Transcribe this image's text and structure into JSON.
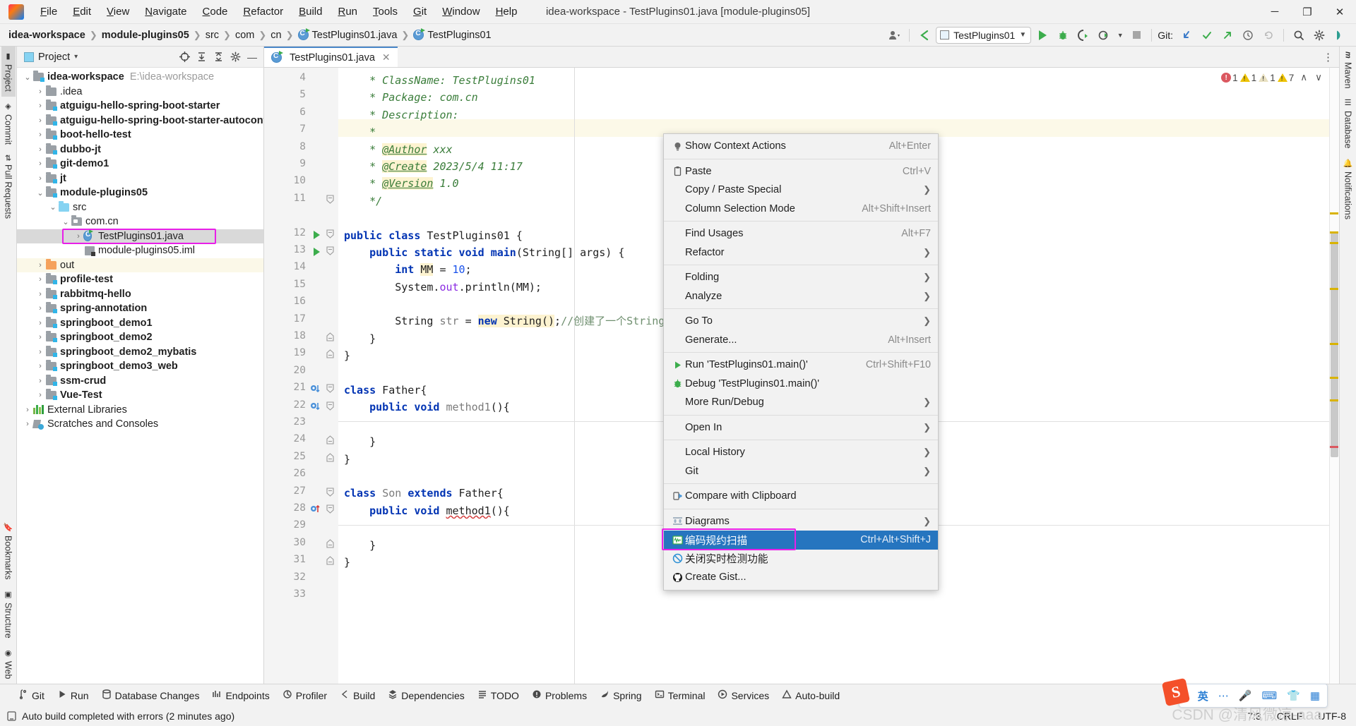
{
  "window": {
    "title": "idea-workspace - TestPlugins01.java [module-plugins05]",
    "minimize": "─",
    "maximize": "❐",
    "close": "✕",
    "logo_text": "IJ"
  },
  "menubar": [
    {
      "label": "File"
    },
    {
      "label": "Edit"
    },
    {
      "label": "View"
    },
    {
      "label": "Navigate"
    },
    {
      "label": "Code"
    },
    {
      "label": "Refactor"
    },
    {
      "label": "Build"
    },
    {
      "label": "Run"
    },
    {
      "label": "Tools"
    },
    {
      "label": "Git"
    },
    {
      "label": "Window"
    },
    {
      "label": "Help"
    }
  ],
  "breadcrumb": [
    {
      "label": "idea-workspace",
      "bold": true,
      "icon": ""
    },
    {
      "label": "module-plugins05",
      "bold": true,
      "icon": ""
    },
    {
      "label": "src",
      "bold": false,
      "icon": ""
    },
    {
      "label": "com",
      "bold": false,
      "icon": ""
    },
    {
      "label": "cn",
      "bold": false,
      "icon": ""
    },
    {
      "label": "TestPlugins01.java",
      "bold": false,
      "icon": "class-icon"
    },
    {
      "label": "TestPlugins01",
      "bold": false,
      "icon": "class-icon"
    }
  ],
  "toolbar": {
    "run_config": "TestPlugins01",
    "git_label": "Git:",
    "icons": [
      "user-icon",
      "back-arrow-icon",
      "run-icon",
      "debug-icon",
      "run-coverage-icon",
      "profile-icon",
      "stop-icon",
      "git-update-icon",
      "git-commit-icon",
      "git-push-icon",
      "history-icon",
      "rollback-icon",
      "search-everywhere-icon",
      "settings-icon",
      "ide-assistant-icon"
    ]
  },
  "left_strip": [
    {
      "label": "Project",
      "icon": "project-icon",
      "active": true
    },
    {
      "label": "Commit",
      "icon": "commit-icon",
      "active": false
    },
    {
      "label": "Pull Requests",
      "icon": "pull-requests-icon",
      "active": false
    },
    {
      "label": "Bookmarks",
      "icon": "bookmarks-icon",
      "active": false
    },
    {
      "label": "Structure",
      "icon": "structure-icon",
      "active": false
    },
    {
      "label": "Web",
      "icon": "web-icon",
      "active": false
    }
  ],
  "right_strip": [
    {
      "label": "Maven",
      "icon": "maven-icon"
    },
    {
      "label": "Database",
      "icon": "database-icon"
    },
    {
      "label": "Notifications",
      "icon": "notifications-icon"
    }
  ],
  "project_panel": {
    "title": "Project",
    "dropdown": "▾",
    "actions": [
      "select-opened-file-icon",
      "expand-all-icon",
      "collapse-all-icon",
      "settings-icon",
      "hide-icon"
    ],
    "tree": [
      {
        "indent": 0,
        "arrow": "⌄",
        "icon": "module-folder",
        "label": "idea-workspace",
        "bold": true,
        "sub": "E:\\idea-workspace",
        "state": ""
      },
      {
        "indent": 1,
        "arrow": "›",
        "icon": "plain-folder",
        "label": ".idea",
        "bold": false,
        "sub": "",
        "state": ""
      },
      {
        "indent": 1,
        "arrow": "›",
        "icon": "module-folder",
        "label": "atguigu-hello-spring-boot-starter",
        "bold": true,
        "sub": "",
        "state": ""
      },
      {
        "indent": 1,
        "arrow": "›",
        "icon": "module-folder",
        "label": "atguigu-hello-spring-boot-starter-autoconfigu",
        "bold": true,
        "sub": "",
        "state": ""
      },
      {
        "indent": 1,
        "arrow": "›",
        "icon": "module-folder",
        "label": "boot-hello-test",
        "bold": true,
        "sub": "",
        "state": ""
      },
      {
        "indent": 1,
        "arrow": "›",
        "icon": "module-folder",
        "label": "dubbo-jt",
        "bold": true,
        "sub": "",
        "state": ""
      },
      {
        "indent": 1,
        "arrow": "›",
        "icon": "module-folder",
        "label": "git-demo1",
        "bold": true,
        "sub": "",
        "state": ""
      },
      {
        "indent": 1,
        "arrow": "›",
        "icon": "module-folder",
        "label": "jt",
        "bold": true,
        "sub": "",
        "state": ""
      },
      {
        "indent": 1,
        "arrow": "⌄",
        "icon": "module-folder",
        "label": "module-plugins05",
        "bold": true,
        "sub": "",
        "state": ""
      },
      {
        "indent": 2,
        "arrow": "⌄",
        "icon": "src-folder",
        "label": "src",
        "bold": false,
        "sub": "",
        "state": ""
      },
      {
        "indent": 3,
        "arrow": "⌄",
        "icon": "pkg-folder",
        "label": "com.cn",
        "bold": false,
        "sub": "",
        "state": ""
      },
      {
        "indent": 4,
        "arrow": "›",
        "icon": "class-icon",
        "label": "TestPlugins01.java",
        "bold": false,
        "sub": "",
        "state": "sel"
      },
      {
        "indent": 4,
        "arrow": "",
        "icon": "iml-icon",
        "label": "module-plugins05.iml",
        "bold": false,
        "sub": "",
        "state": ""
      },
      {
        "indent": 1,
        "arrow": "›",
        "icon": "out-folder",
        "label": "out",
        "bold": false,
        "sub": "",
        "state": "hl"
      },
      {
        "indent": 1,
        "arrow": "›",
        "icon": "module-folder",
        "label": "profile-test",
        "bold": true,
        "sub": "",
        "state": ""
      },
      {
        "indent": 1,
        "arrow": "›",
        "icon": "module-folder",
        "label": "rabbitmq-hello",
        "bold": true,
        "sub": "",
        "state": ""
      },
      {
        "indent": 1,
        "arrow": "›",
        "icon": "module-folder",
        "label": "spring-annotation",
        "bold": true,
        "sub": "",
        "state": ""
      },
      {
        "indent": 1,
        "arrow": "›",
        "icon": "module-folder",
        "label": "springboot_demo1",
        "bold": true,
        "sub": "",
        "state": ""
      },
      {
        "indent": 1,
        "arrow": "›",
        "icon": "module-folder",
        "label": "springboot_demo2",
        "bold": true,
        "sub": "",
        "state": ""
      },
      {
        "indent": 1,
        "arrow": "›",
        "icon": "module-folder",
        "label": "springboot_demo2_mybatis",
        "bold": true,
        "sub": "",
        "state": ""
      },
      {
        "indent": 1,
        "arrow": "›",
        "icon": "module-folder",
        "label": "springboot_demo3_web",
        "bold": true,
        "sub": "",
        "state": ""
      },
      {
        "indent": 1,
        "arrow": "›",
        "icon": "module-folder",
        "label": "ssm-crud",
        "bold": true,
        "sub": "",
        "state": ""
      },
      {
        "indent": 1,
        "arrow": "›",
        "icon": "module-folder",
        "label": "Vue-Test",
        "bold": true,
        "sub": "",
        "state": ""
      },
      {
        "indent": 0,
        "arrow": "›",
        "icon": "library-icon",
        "label": "External Libraries",
        "bold": false,
        "sub": "",
        "state": ""
      },
      {
        "indent": 0,
        "arrow": "›",
        "icon": "scratch-icon",
        "label": "Scratches and Consoles",
        "bold": false,
        "sub": "",
        "state": ""
      }
    ]
  },
  "editor": {
    "tab": {
      "label": "TestPlugins01.java",
      "close": "✕",
      "icon": "class-icon"
    },
    "inspections": {
      "errors": "1",
      "warnings": "1",
      "weak_warnings": "1",
      "other_warnings": "7",
      "up": "∧",
      "down": "∨"
    },
    "lines": [
      {
        "n": "4",
        "html": "    <span class='cm'>* ClassName: TestPlugins01</span>"
      },
      {
        "n": "5",
        "html": "    <span class='cm'>* Package: com.cn</span>"
      },
      {
        "n": "6",
        "html": "    <span class='cm'>* Description:</span>"
      },
      {
        "n": "7",
        "html": "    <span class='cm'>*</span>"
      },
      {
        "n": "8",
        "html": "    <span class='cm'>* </span><span class='an'>@Author</span><span class='cm'> xxx</span>"
      },
      {
        "n": "9",
        "html": "    <span class='cm'>* </span><span class='an'>@Create</span><span class='cm'> 2023/5/4 11:17</span>"
      },
      {
        "n": "10",
        "html": "    <span class='cm'>* </span><span class='an'>@Version</span><span class='cm'> 1.0</span>"
      },
      {
        "n": "11",
        "html": "    <span class='cm'>*/</span>"
      },
      {
        "n": "",
        "html": ""
      },
      {
        "n": "12",
        "html": "<span class='k'>public class</span> TestPlugins01 {"
      },
      {
        "n": "13",
        "html": "    <span class='k'>public static void</span> <span class='k'>main</span>(String[] args) {"
      },
      {
        "n": "14",
        "html": "        <span class='k'>int</span> <span class='hlv'>MM</span> = <span class='num'>10</span>;"
      },
      {
        "n": "15",
        "html": "        System.<span class='fld'>out</span>.println(MM);"
      },
      {
        "n": "16",
        "html": ""
      },
      {
        "n": "17",
        "html": "        String <span class='grey'>str</span> = <span class='hlv'><span class='k'>new</span> String()</span>;<span class='cmn'>//创建了一个String的实例</span>"
      },
      {
        "n": "18",
        "html": "    }"
      },
      {
        "n": "19",
        "html": "}"
      },
      {
        "n": "20",
        "html": ""
      },
      {
        "n": "21",
        "html": "<span class='k'>class</span> Father{"
      },
      {
        "n": "22",
        "html": "    <span class='k'>public void</span> <span class='grey'>method1</span>(){"
      },
      {
        "n": "23",
        "html": ""
      },
      {
        "n": "24",
        "html": "    }"
      },
      {
        "n": "25",
        "html": "}"
      },
      {
        "n": "26",
        "html": ""
      },
      {
        "n": "27",
        "html": "<span class='k'>class</span> <span class='grey'>Son</span> <span class='k'>extends</span> Father{"
      },
      {
        "n": "28",
        "html": "    <span class='k'>public void</span> <span class='err-u'>method1</span>(){"
      },
      {
        "n": "29",
        "html": ""
      },
      {
        "n": "30",
        "html": "    }"
      },
      {
        "n": "31",
        "html": "}"
      },
      {
        "n": "32",
        "html": ""
      },
      {
        "n": "33",
        "html": ""
      }
    ]
  },
  "context_menu": {
    "items": [
      {
        "label": "Show Context Actions",
        "accel": "Alt+Enter",
        "icon": "lightbulb-icon",
        "arrow": false,
        "sep_after": true,
        "active": false
      },
      {
        "label": "Paste",
        "accel": "Ctrl+V",
        "icon": "clipboard-icon",
        "arrow": false,
        "sep_after": false,
        "active": false
      },
      {
        "label": "Copy / Paste Special",
        "accel": "",
        "icon": "",
        "arrow": true,
        "sep_after": false,
        "active": false
      },
      {
        "label": "Column Selection Mode",
        "accel": "Alt+Shift+Insert",
        "icon": "",
        "arrow": false,
        "sep_after": true,
        "active": false
      },
      {
        "label": "Find Usages",
        "accel": "Alt+F7",
        "icon": "",
        "arrow": false,
        "sep_after": false,
        "active": false
      },
      {
        "label": "Refactor",
        "accel": "",
        "icon": "",
        "arrow": true,
        "sep_after": true,
        "active": false
      },
      {
        "label": "Folding",
        "accel": "",
        "icon": "",
        "arrow": true,
        "sep_after": false,
        "active": false
      },
      {
        "label": "Analyze",
        "accel": "",
        "icon": "",
        "arrow": true,
        "sep_after": true,
        "active": false
      },
      {
        "label": "Go To",
        "accel": "",
        "icon": "",
        "arrow": true,
        "sep_after": false,
        "active": false
      },
      {
        "label": "Generate...",
        "accel": "Alt+Insert",
        "icon": "",
        "arrow": false,
        "sep_after": true,
        "active": false
      },
      {
        "label": "Run 'TestPlugins01.main()'",
        "accel": "Ctrl+Shift+F10",
        "icon": "run-icon",
        "arrow": false,
        "sep_after": false,
        "active": false
      },
      {
        "label": "Debug 'TestPlugins01.main()'",
        "accel": "",
        "icon": "debug-icon",
        "arrow": false,
        "sep_after": false,
        "active": false
      },
      {
        "label": "More Run/Debug",
        "accel": "",
        "icon": "",
        "arrow": true,
        "sep_after": true,
        "active": false
      },
      {
        "label": "Open In",
        "accel": "",
        "icon": "",
        "arrow": true,
        "sep_after": true,
        "active": false
      },
      {
        "label": "Local History",
        "accel": "",
        "icon": "",
        "arrow": true,
        "sep_after": false,
        "active": false
      },
      {
        "label": "Git",
        "accel": "",
        "icon": "",
        "arrow": true,
        "sep_after": true,
        "active": false
      },
      {
        "label": "Compare with Clipboard",
        "accel": "",
        "icon": "compare-icon",
        "arrow": false,
        "sep_after": true,
        "active": false
      },
      {
        "label": "Diagrams",
        "accel": "",
        "icon": "diagram-icon",
        "arrow": true,
        "sep_after": false,
        "active": false
      },
      {
        "label": "编码规约扫描",
        "accel": "Ctrl+Alt+Shift+J",
        "icon": "scan-icon",
        "arrow": false,
        "sep_after": false,
        "active": true
      },
      {
        "label": "关闭实时检测功能",
        "accel": "",
        "icon": "disable-icon",
        "arrow": false,
        "sep_after": false,
        "active": false
      },
      {
        "label": "Create Gist...",
        "accel": "",
        "icon": "github-icon",
        "arrow": false,
        "sep_after": false,
        "active": false
      }
    ]
  },
  "tool_windows": [
    {
      "label": "Git",
      "icon": "git-icon"
    },
    {
      "label": "Run",
      "icon": "run-icon"
    },
    {
      "label": "Database Changes",
      "icon": "database-changes-icon"
    },
    {
      "label": "Endpoints",
      "icon": "endpoints-icon"
    },
    {
      "label": "Profiler",
      "icon": "profiler-icon"
    },
    {
      "label": "Build",
      "icon": "build-icon"
    },
    {
      "label": "Dependencies",
      "icon": "dependencies-icon"
    },
    {
      "label": "TODO",
      "icon": "todo-icon"
    },
    {
      "label": "Problems",
      "icon": "problems-icon"
    },
    {
      "label": "Spring",
      "icon": "spring-icon"
    },
    {
      "label": "Terminal",
      "icon": "terminal-icon"
    },
    {
      "label": "Services",
      "icon": "services-icon"
    },
    {
      "label": "Auto-build",
      "icon": "auto-build-icon"
    }
  ],
  "status_bar": {
    "message": "Auto build completed with errors (2 minutes ago)",
    "caret": "7:3",
    "line_sep": "CRLF",
    "encoding": "UTF-8",
    "icon": "build-status-icon"
  },
  "ime": {
    "logo": "S",
    "mode": "英",
    "icons": [
      "handwriting-icon",
      "voice-icon",
      "keyboard-icon",
      "skin-icon",
      "apps-icon"
    ]
  },
  "watermark": "CSDN @清风微凉-aaa",
  "colors": {
    "accent": "#2675bf",
    "highlight_box": "#e81fe8",
    "error": "#db5860",
    "warning": "#edc200",
    "run_green": "#3cad4c"
  }
}
